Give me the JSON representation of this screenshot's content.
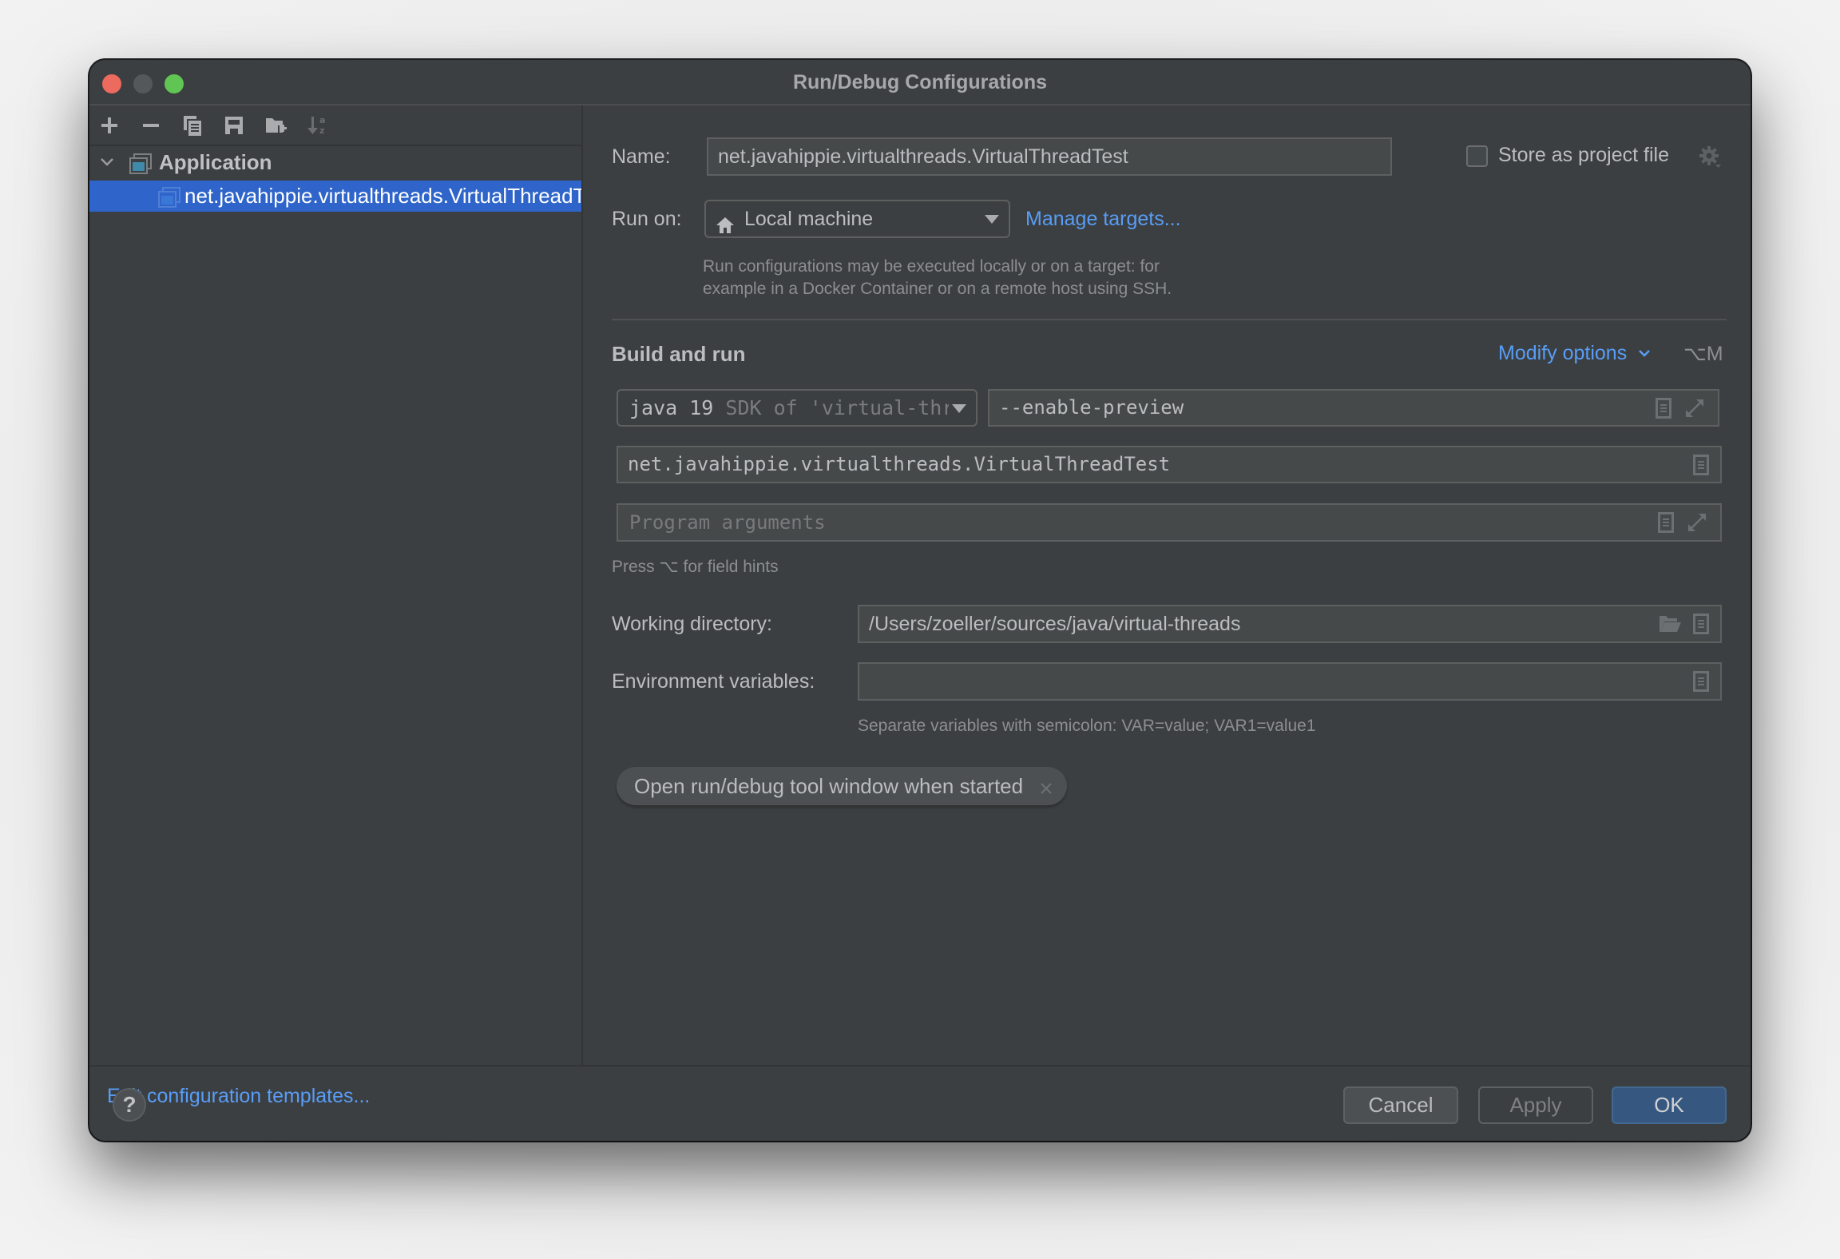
{
  "window": {
    "title": "Run/Debug Configurations"
  },
  "sidebar": {
    "toolbar": [
      {
        "name": "add",
        "icon": "plus-icon"
      },
      {
        "name": "remove",
        "icon": "minus-icon"
      },
      {
        "name": "copy",
        "icon": "copy-icon"
      },
      {
        "name": "save",
        "icon": "save-icon"
      },
      {
        "name": "new-folder",
        "icon": "new-folder-icon"
      },
      {
        "name": "sort",
        "icon": "sort-alpha-icon"
      }
    ],
    "tree": {
      "group_label": "Application",
      "selected_item": "net.javahippie.virtualthreads.VirtualThreadTest"
    },
    "edit_templates_link": "Edit configuration templates..."
  },
  "form": {
    "name_label": "Name:",
    "name_value": "net.javahippie.virtualthreads.VirtualThreadTest",
    "store_as_project_file": {
      "label": "Store as project file",
      "checked": false
    },
    "run_on_label": "Run on:",
    "run_on_value": "Local machine",
    "manage_targets_link": "Manage targets...",
    "run_on_description_line1": "Run configurations may be executed locally or on a target: for",
    "run_on_description_line2": "example in a Docker Container or on a remote host using SSH.",
    "build_and_run": {
      "title": "Build and run",
      "modify_options": "Modify options",
      "modify_options_shortcut": "⌥M",
      "jre_value": "java 19",
      "jre_detail": "SDK of 'virtual-threads'",
      "vm_options_value": "--enable-preview",
      "main_class_value": "net.javahippie.virtualthreads.VirtualThreadTest",
      "program_args_placeholder": "Program arguments",
      "field_hint": "Press ⌥ for field hints"
    },
    "working_directory_label": "Working directory:",
    "working_directory_value": "/Users/zoeller/sources/java/virtual-threads",
    "env_vars_label": "Environment variables:",
    "env_vars_value": "",
    "env_vars_hint": "Separate variables with semicolon: VAR=value; VAR1=value1",
    "chip_label": "Open run/debug tool window when started"
  },
  "footer": {
    "help": "?",
    "cancel": "Cancel",
    "apply": "Apply",
    "ok": "OK"
  },
  "colors": {
    "accent_link": "#589df6",
    "selection": "#2f65ca",
    "ok_button": "#365880",
    "background": "#3c3f41"
  }
}
